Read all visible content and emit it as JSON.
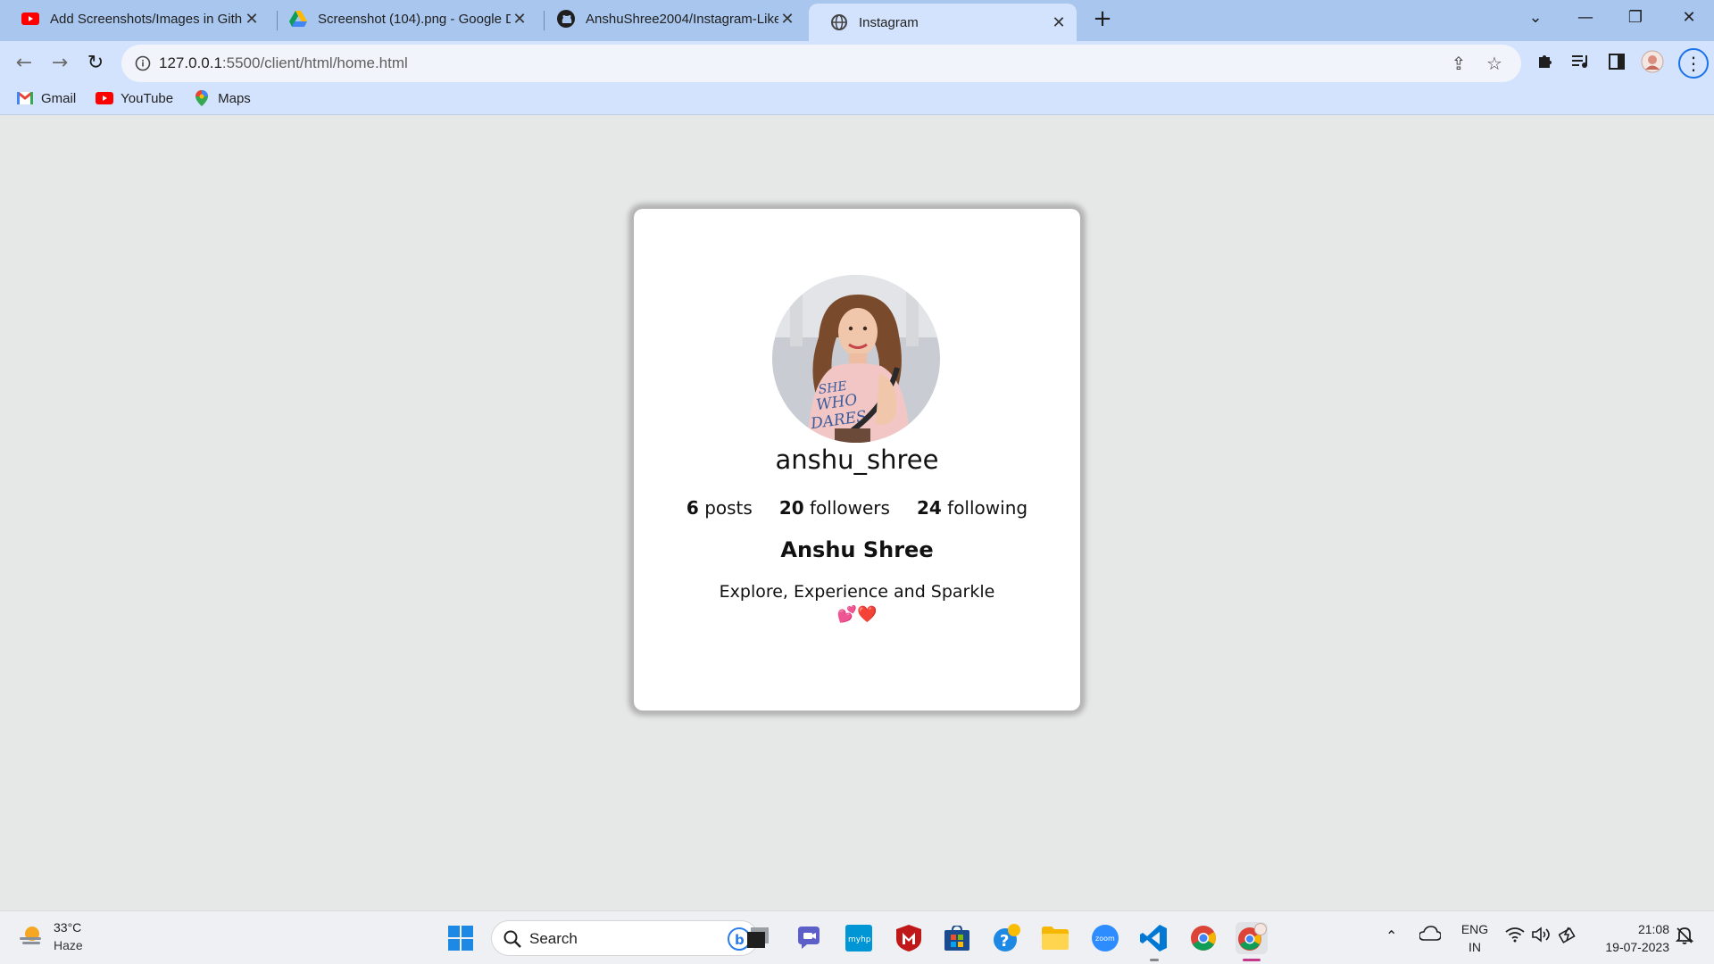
{
  "browser": {
    "tabs": [
      {
        "title": "Add Screenshots/Images in Githu",
        "icon": "youtube-icon",
        "active": false
      },
      {
        "title": "Screenshot (104).png - Google D",
        "icon": "google-drive-icon",
        "active": false
      },
      {
        "title": "AnshuShree2004/Instagram-Like",
        "icon": "github-icon",
        "active": false
      },
      {
        "title": "Instagram",
        "icon": "globe-icon",
        "active": true
      }
    ],
    "url_host": "127.0.0.1",
    "url_path": ":5500/client/html/home.html",
    "bookmarks": [
      {
        "label": "Gmail",
        "icon": "gmail-icon"
      },
      {
        "label": "YouTube",
        "icon": "youtube-icon"
      },
      {
        "label": "Maps",
        "icon": "maps-icon"
      }
    ]
  },
  "profile": {
    "username": "anshu_shree",
    "posts_count": "6",
    "posts_label": "posts",
    "followers_count": "20",
    "followers_label": "followers",
    "following_count": "24",
    "following_label": "following",
    "full_name": "Anshu Shree",
    "bio": "Explore, Experience and Sparkle",
    "bio_emoji": "💕❤️",
    "avatar_shirt_text": "SHE WHO DARES"
  },
  "taskbar": {
    "weather_temp": "33°C",
    "weather_condition": "Haze",
    "search_label": "Search",
    "language_top": "ENG",
    "language_bottom": "IN",
    "time": "21:08",
    "date": "19-07-2023"
  },
  "colors": {
    "tab_strip": "#a9c6ee",
    "toolbar": "#d3e3fd",
    "page_bg": "#e6e7e7",
    "card_bg": "#ffffff"
  }
}
